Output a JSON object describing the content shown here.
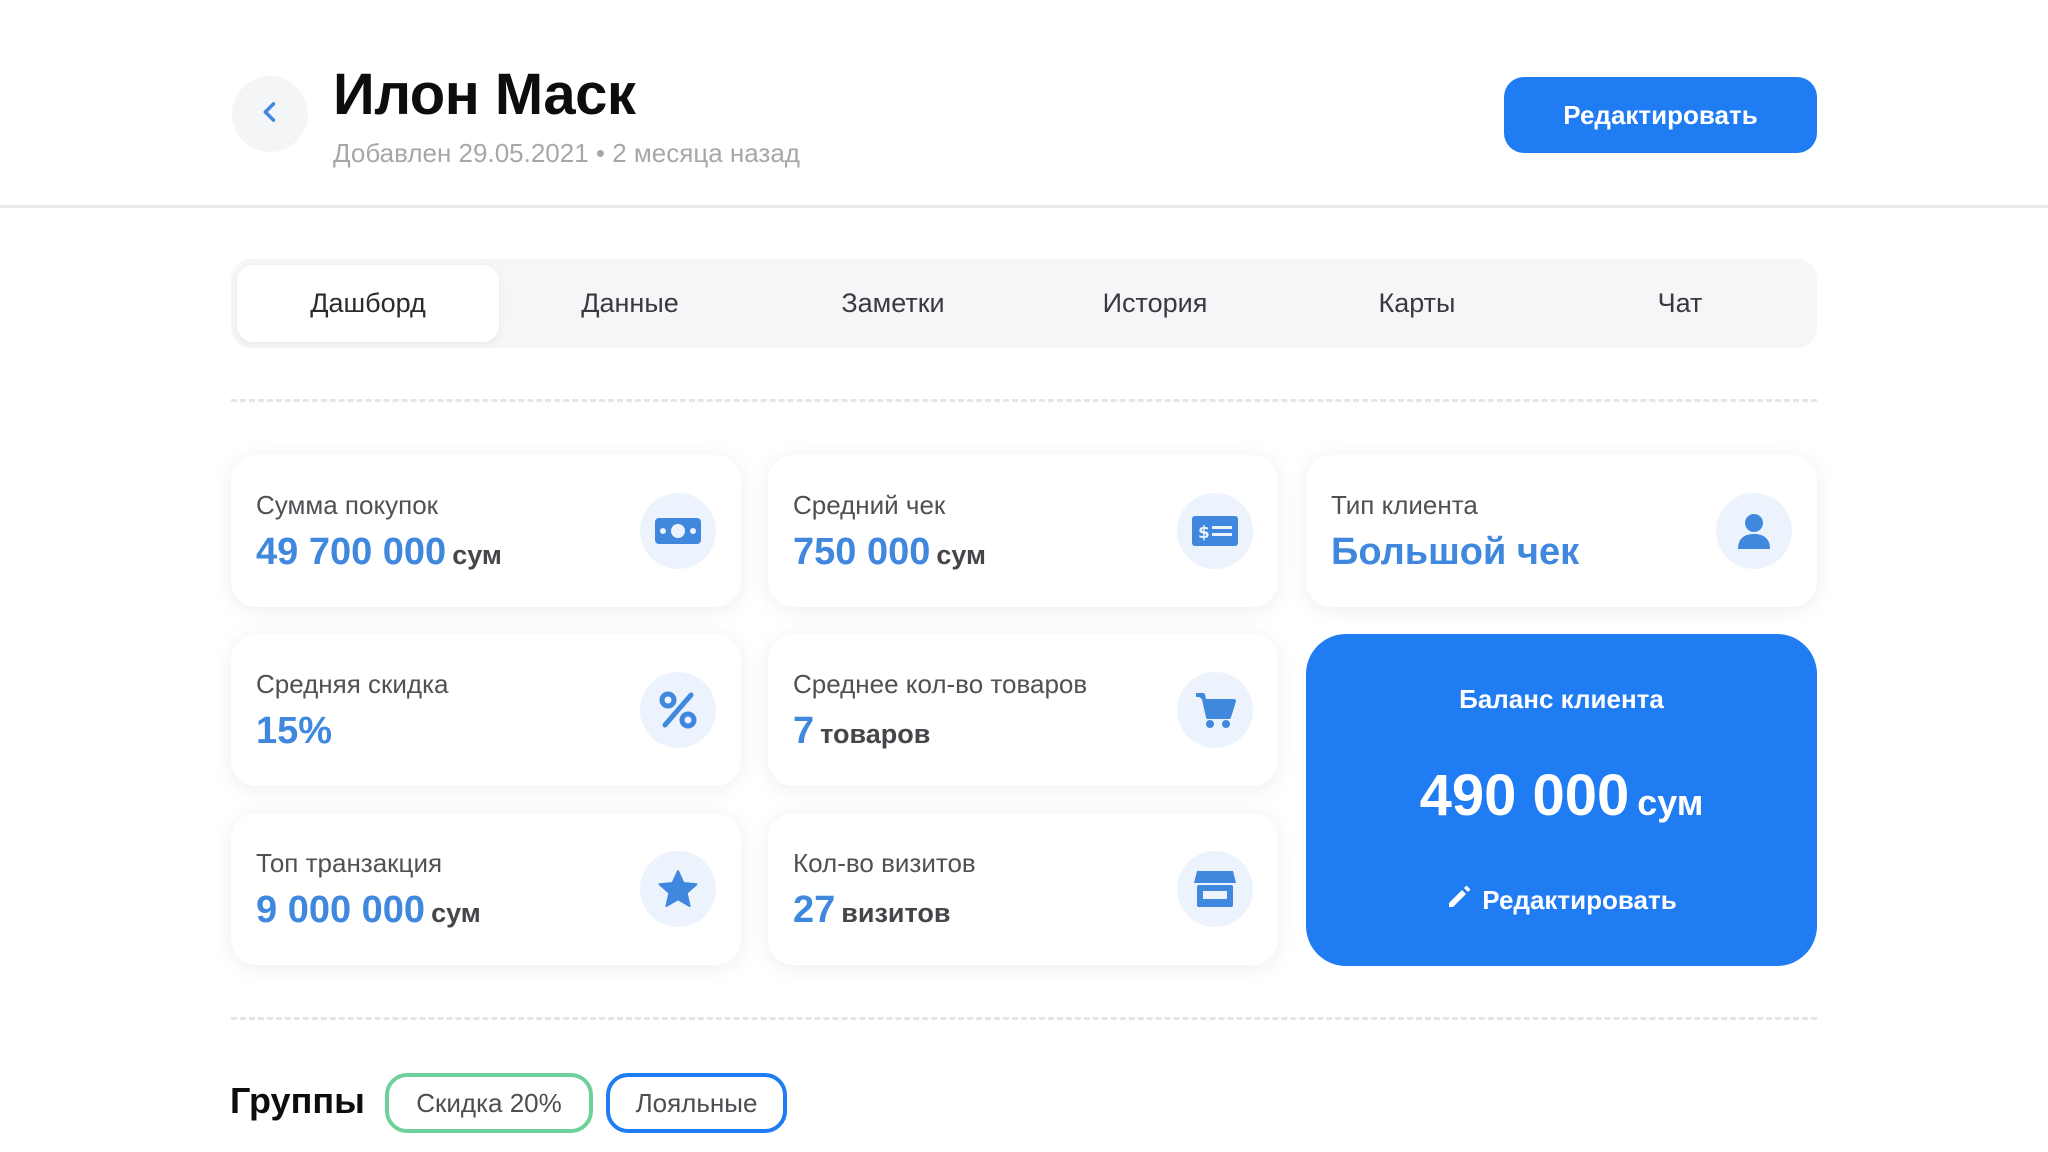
{
  "header": {
    "title": "Илон Маск",
    "subtitle": "Добавлен 29.05.2021 • 2 месяца назад",
    "edit_label": "Редактировать",
    "back_icon": "chevron-left-icon",
    "accent": "#1f7cf3"
  },
  "tabs": [
    {
      "label": "Дашборд",
      "active": true
    },
    {
      "label": "Данные",
      "active": false
    },
    {
      "label": "Заметки",
      "active": false
    },
    {
      "label": "История",
      "active": false
    },
    {
      "label": "Карты",
      "active": false
    },
    {
      "label": "Чат",
      "active": false
    }
  ],
  "stats": {
    "purchase_sum": {
      "label": "Сумма покупок",
      "value": "49 700 000",
      "unit": "сум",
      "icon": "banknote-icon"
    },
    "avg_check": {
      "label": "Средний чек",
      "value": "750 000",
      "unit": "сум",
      "icon": "receipt-icon"
    },
    "client_type": {
      "label": "Тип клиента",
      "value": "Большой чек",
      "icon": "user-icon"
    },
    "avg_discount": {
      "label": "Средняя скидка",
      "value": "15%",
      "icon": "percent-icon"
    },
    "avg_items": {
      "label": "Среднее кол-во товаров",
      "value": "7",
      "unit": "товаров",
      "icon": "cart-icon"
    },
    "top_transaction": {
      "label": "Топ транзакция",
      "value": "9 000 000",
      "unit": "сум",
      "icon": "star-icon"
    },
    "visits": {
      "label": "Кол-во визитов",
      "value": "27",
      "unit": "визитов",
      "icon": "store-icon"
    }
  },
  "balance": {
    "title": "Баланс клиента",
    "value": "490 000",
    "unit": "сум",
    "edit_label": "Редактировать",
    "icon": "pencil-icon"
  },
  "groups": {
    "title": "Группы",
    "chips": [
      {
        "label": "Скидка 20%",
        "color": "#6fd19a"
      },
      {
        "label": "Лояльные",
        "color": "#1f7cf3"
      }
    ]
  }
}
